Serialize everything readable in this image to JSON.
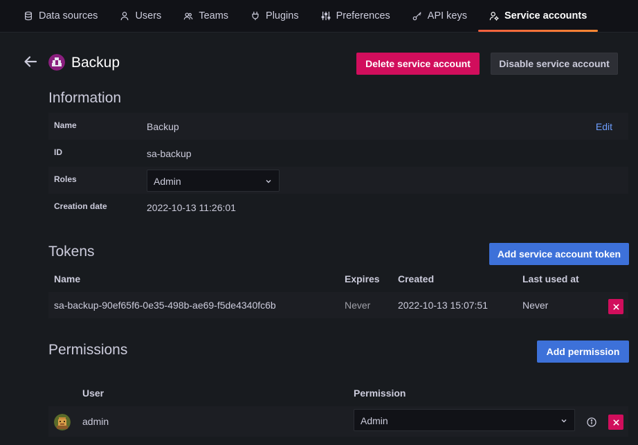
{
  "nav": {
    "tabs": [
      {
        "label": "Data sources",
        "icon": "database-icon"
      },
      {
        "label": "Users",
        "icon": "user-icon"
      },
      {
        "label": "Teams",
        "icon": "users-icon"
      },
      {
        "label": "Plugins",
        "icon": "plug-icon"
      },
      {
        "label": "Preferences",
        "icon": "sliders-icon"
      },
      {
        "label": "API keys",
        "icon": "key-icon"
      },
      {
        "label": "Service accounts",
        "icon": "user-cog-icon",
        "active": true
      }
    ]
  },
  "header": {
    "title": "Backup",
    "delete_label": "Delete service account",
    "disable_label": "Disable service account"
  },
  "information": {
    "title": "Information",
    "name_label": "Name",
    "name_value": "Backup",
    "edit_label": "Edit",
    "id_label": "ID",
    "id_value": "sa-backup",
    "roles_label": "Roles",
    "roles_value": "Admin",
    "creation_label": "Creation date",
    "creation_value": "2022-10-13 11:26:01"
  },
  "tokens": {
    "title": "Tokens",
    "add_label": "Add service account token",
    "columns": [
      "Name",
      "Expires",
      "Created",
      "Last used at"
    ],
    "rows": [
      {
        "name": "sa-backup-90ef65f6-0e35-498b-ae69-f5de4340fc6b",
        "expires": "Never",
        "created": "2022-10-13 15:07:51",
        "last_used": "Never"
      }
    ]
  },
  "permissions": {
    "title": "Permissions",
    "add_label": "Add permission",
    "columns": [
      "User",
      "Permission"
    ],
    "rows": [
      {
        "user": "admin",
        "permission": "Admin"
      }
    ]
  },
  "colors": {
    "background": "#111217",
    "panel": "#181b1f",
    "danger": "#d10e5c",
    "primary": "#3d71d9",
    "link": "#6e9fff",
    "active_tab_underline": "#f55f3e"
  }
}
